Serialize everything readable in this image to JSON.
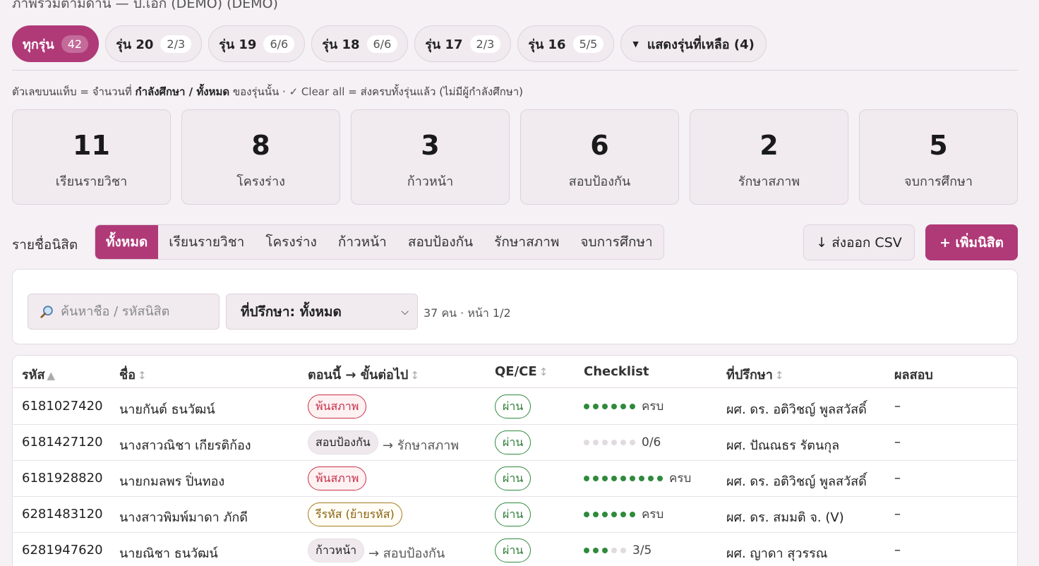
{
  "page_title": "ภาพรวมตามด่าน — ป.เอก (DEMO) (DEMO)",
  "cohorts": [
    {
      "label": "ทุกรุ่น",
      "count": "42",
      "active": true
    },
    {
      "label": "รุ่น 20",
      "count": "2/3"
    },
    {
      "label": "รุ่น 19",
      "count": "6/6"
    },
    {
      "label": "รุ่น 18",
      "count": "6/6"
    },
    {
      "label": "รุ่น 17",
      "count": "2/3"
    },
    {
      "label": "รุ่น 16",
      "count": "5/5"
    }
  ],
  "show_more_label": "แสดงรุ่นที่เหลือ (4)",
  "legend": {
    "prefix": "ตัวเลขบนแท็บ = จำนวนที่ ",
    "active": "กำลังศึกษา",
    "sep": " / ",
    "total": "ทั้งหมด",
    "mid": " ของรุ่นนั้น · ",
    "clear": "✓ Clear all",
    "suffix": "  = ส่งครบทั้งรุ่นแล้ว (ไม่มีผู้กำลังศึกษา)"
  },
  "stats": [
    {
      "value": "11",
      "label": "เรียนรายวิชา"
    },
    {
      "value": "8",
      "label": "โครงร่าง"
    },
    {
      "value": "3",
      "label": "ก้าวหน้า"
    },
    {
      "value": "6",
      "label": "สอบป้องกัน"
    },
    {
      "value": "2",
      "label": "รักษาสภาพ"
    },
    {
      "value": "5",
      "label": "จบการศึกษา"
    }
  ],
  "list_label": "รายชื่อนิสิต",
  "tabs": [
    "ทั้งหมด",
    "เรียนรายวิชา",
    "โครงร่าง",
    "ก้าวหน้า",
    "สอบป้องกัน",
    "รักษาสภาพ",
    "จบการศึกษา"
  ],
  "export_label": "↓ ส่งออก CSV",
  "add_label": "+ เพิ่มนิสิต",
  "search_placeholder": "ค้นหาชื่อ / รหัสนิสิต",
  "advisor_filter": "ที่ปรึกษา: ทั้งหมด",
  "result_count": "37 คน · หน้า 1/2",
  "table": {
    "headers": {
      "id": "รหัส",
      "name": "ชื่อ",
      "stage": "ตอนนี้ → ขั้นต่อไป",
      "qe": "QE/CE",
      "checklist": "Checklist",
      "advisor": "ที่ปรึกษา",
      "result": "ผลสอบ"
    },
    "rows": [
      {
        "id": "6181027420",
        "name": "นายกันต์ ธนวัฒน์",
        "stage": "พ้นสภาพ",
        "stage_style": "red",
        "next": "",
        "qe": "ผ่าน",
        "checklist_done": 6,
        "checklist_total": 6,
        "checklist_text": "ครบ",
        "advisor": "ผศ. ดร. อติวิชญ์ พูลสวัสดิ์",
        "result": "–"
      },
      {
        "id": "6181427120",
        "name": "นางสาวณิชา เกียรติก้อง",
        "stage": "สอบป้องกัน",
        "stage_style": "gray",
        "next": "→ รักษาสภาพ",
        "qe": "ผ่าน",
        "checklist_done": 0,
        "checklist_total": 6,
        "checklist_text": "0/6",
        "advisor": "ผศ. ปัณณธร รัตนกุล",
        "result": "–"
      },
      {
        "id": "6181928820",
        "name": "นายกมลพร ปิ่นทอง",
        "stage": "พ้นสภาพ",
        "stage_style": "red",
        "next": "",
        "qe": "ผ่าน",
        "checklist_done": 9,
        "checklist_total": 9,
        "checklist_text": "ครบ",
        "advisor": "ผศ. ดร. อติวิชญ์ พูลสวัสดิ์",
        "result": "–"
      },
      {
        "id": "6281483120",
        "name": "นางสาวพิมพ์มาดา ภักดี",
        "stage": "รีรหัส (ย้ายรหัส)",
        "stage_style": "gold",
        "next": "",
        "qe": "ผ่าน",
        "checklist_done": 6,
        "checklist_total": 6,
        "checklist_text": "ครบ",
        "advisor": "ผศ. ดร. สมมติ จ. (V)",
        "result": "–"
      },
      {
        "id": "6281947620",
        "name": "นายณิชา ธนวัฒน์",
        "stage": "ก้าวหน้า",
        "stage_style": "gray",
        "next": "→ สอบป้องกัน",
        "qe": "ผ่าน",
        "checklist_done": 3,
        "checklist_total": 5,
        "checklist_text": "3/5",
        "advisor": "ผศ. ญาดา สุวรรณ",
        "result": "–"
      }
    ]
  },
  "colors": {
    "accent": "#b03a78",
    "pass_green": "#2f8a3c",
    "danger_red": "#c9304a",
    "warn_gold": "#a67c1e"
  }
}
